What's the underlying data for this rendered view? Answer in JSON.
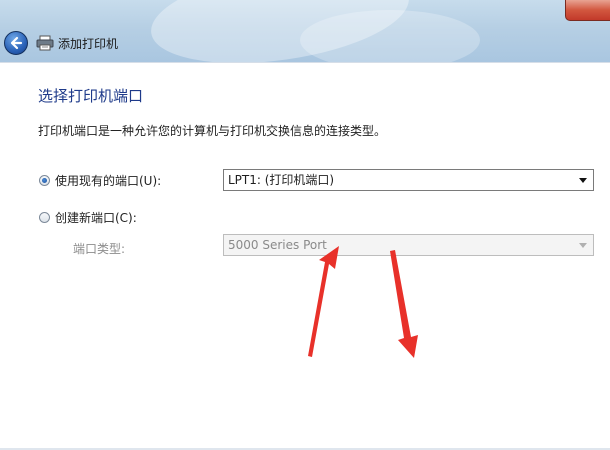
{
  "window": {
    "title": "添加打印机"
  },
  "page": {
    "heading": "选择打印机端口",
    "description": "打印机端口是一种允许您的计算机与打印机交换信息的连接类型。"
  },
  "options": {
    "existing_port": {
      "label": "使用现有的端口(U):",
      "selected": true,
      "value": "LPT1: (打印机端口)"
    },
    "new_port": {
      "label": "创建新端口(C):",
      "selected": false,
      "type_label": "端口类型:",
      "type_value": "5000 Series Port"
    }
  },
  "colors": {
    "heading": "#1e3a8a",
    "annotation_arrow": "#e8312a"
  },
  "icons": {
    "back": "back-arrow-icon",
    "printer": "printer-icon",
    "close": "close-icon"
  }
}
